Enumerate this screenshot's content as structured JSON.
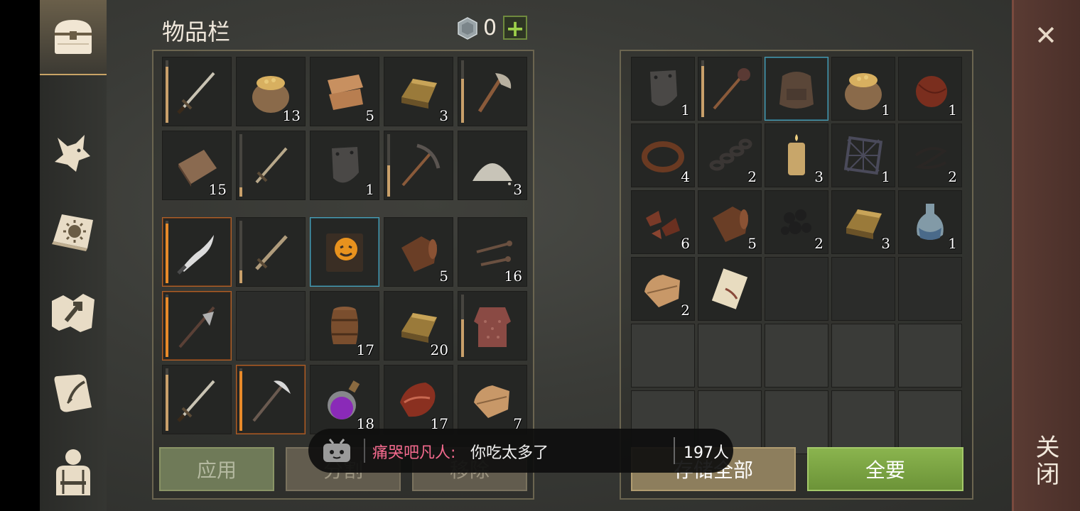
{
  "window": {
    "title": "物品栏",
    "close_label": "关闭"
  },
  "currency": {
    "icon": "silver-coin-icon",
    "count": "0",
    "add_label": "+"
  },
  "sidebar": {
    "tabs": [
      {
        "name": "inventory-chest-icon",
        "active": true
      },
      {
        "name": "wolf-icon",
        "active": false
      },
      {
        "name": "skills-book-icon",
        "active": false
      },
      {
        "name": "map-icon",
        "active": false
      },
      {
        "name": "quest-scroll-icon",
        "active": false
      },
      {
        "name": "character-equipment-icon",
        "active": false
      }
    ]
  },
  "inventory_top": [
    {
      "item": "longsword",
      "count": "",
      "durability": 0.9,
      "frame": ""
    },
    {
      "item": "grain-sack",
      "count": "13"
    },
    {
      "item": "cloth-scraps",
      "count": "5"
    },
    {
      "item": "bronze-ingot",
      "count": "3"
    },
    {
      "item": "axe",
      "count": "",
      "durability": 0.7
    },
    {
      "item": "wooden-plank",
      "count": "15"
    },
    {
      "item": "sword",
      "count": "",
      "durability": 0.15
    },
    {
      "item": "iron-shield-plate",
      "count": "1"
    },
    {
      "item": "pickaxe",
      "count": "",
      "durability": 0.5
    },
    {
      "item": "sand-pile",
      "count": "3"
    }
  ],
  "inventory_bottom": [
    {
      "item": "curved-blade",
      "count": "",
      "durability": 0.95,
      "frame": "orange"
    },
    {
      "item": "short-sword",
      "count": "",
      "durability": 0.2
    },
    {
      "item": "pumpkin-book",
      "count": "",
      "frame": "blue"
    },
    {
      "item": "leather-roll",
      "count": "5"
    },
    {
      "item": "nails",
      "count": "16"
    },
    {
      "item": "halberd",
      "count": "",
      "durability": 0.95,
      "frame": "orange"
    },
    {
      "item": "empty",
      "count": ""
    },
    {
      "item": "barrel",
      "count": "17"
    },
    {
      "item": "bronze-ingot",
      "count": "20"
    },
    {
      "item": "chainmail",
      "count": "",
      "durability": 0.6
    },
    {
      "item": "longsword",
      "count": "",
      "durability": 0.9
    },
    {
      "item": "war-pick",
      "count": "",
      "durability": 0.95,
      "frame": "orange"
    },
    {
      "item": "purple-potion",
      "count": "18"
    },
    {
      "item": "raw-meat",
      "count": "17"
    },
    {
      "item": "folded-cloth",
      "count": "7"
    }
  ],
  "storage": [
    {
      "item": "iron-shield-plate",
      "count": "1"
    },
    {
      "item": "flail-mace",
      "count": "",
      "durability": 0.9
    },
    {
      "item": "backpack",
      "count": "",
      "frame": "blue"
    },
    {
      "item": "grain-sack",
      "count": "1"
    },
    {
      "item": "leather-flask",
      "count": "1"
    },
    {
      "item": "leather-strap",
      "count": "4"
    },
    {
      "item": "chain",
      "count": "2"
    },
    {
      "item": "candle",
      "count": "3"
    },
    {
      "item": "net-frame",
      "count": "1"
    },
    {
      "item": "rope-coil",
      "count": "2"
    },
    {
      "item": "metal-scraps",
      "count": "6"
    },
    {
      "item": "leather-roll",
      "count": "5"
    },
    {
      "item": "coal",
      "count": "2"
    },
    {
      "item": "bronze-ingot",
      "count": "3"
    },
    {
      "item": "glass-bottle",
      "count": "1"
    },
    {
      "item": "folded-cloth",
      "count": "2"
    },
    {
      "item": "scroll",
      "count": ""
    },
    {
      "item": "empty",
      "count": ""
    },
    {
      "item": "empty",
      "count": ""
    },
    {
      "item": "empty",
      "count": ""
    },
    {
      "item": "empty",
      "count": ""
    },
    {
      "item": "empty",
      "count": ""
    },
    {
      "item": "empty",
      "count": ""
    },
    {
      "item": "empty",
      "count": ""
    },
    {
      "item": "empty",
      "count": ""
    },
    {
      "item": "empty",
      "count": ""
    },
    {
      "item": "empty",
      "count": ""
    },
    {
      "item": "empty",
      "count": ""
    },
    {
      "item": "empty",
      "count": ""
    },
    {
      "item": "empty",
      "count": ""
    }
  ],
  "buttons": {
    "apply": "应用",
    "split": "分割",
    "remove": "移除",
    "store_all": "存储全部",
    "take_all": "全要"
  },
  "danmaku": {
    "icon": "bilibili-tv-icon",
    "user": "痛哭吧凡人:",
    "message": "你吃太多了",
    "viewers": "197人"
  }
}
